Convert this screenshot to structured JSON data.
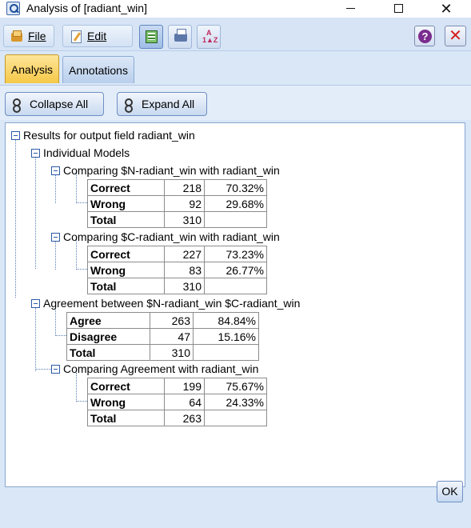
{
  "window": {
    "title": "Analysis of [radiant_win]"
  },
  "menubar": {
    "file_label": "File",
    "edit_label": "Edit"
  },
  "tabs": [
    {
      "label": "Analysis",
      "active": true
    },
    {
      "label": "Annotations",
      "active": false
    }
  ],
  "toolrow": {
    "collapse_label": "Collapse All",
    "expand_label": "Expand All"
  },
  "tree": {
    "root": "Results for output field radiant_win",
    "individual": "Individual Models",
    "cmp_n": "Comparing $N-radiant_win with radiant_win",
    "cmp_c": "Comparing $C-radiant_win with radiant_win",
    "agreement": "Agreement between  $N-radiant_win $C-radiant_win",
    "cmp_agree": "Comparing Agreement with radiant_win"
  },
  "tables": {
    "n_model": [
      {
        "label": "Correct",
        "count": "218",
        "pct": "70.32%"
      },
      {
        "label": "Wrong",
        "count": "92",
        "pct": "29.68%"
      },
      {
        "label": "Total",
        "count": "310",
        "pct": ""
      }
    ],
    "c_model": [
      {
        "label": "Correct",
        "count": "227",
        "pct": "73.23%"
      },
      {
        "label": "Wrong",
        "count": "83",
        "pct": "26.77%"
      },
      {
        "label": "Total",
        "count": "310",
        "pct": ""
      }
    ],
    "agreement": [
      {
        "label": "Agree",
        "count": "263",
        "pct": "84.84%"
      },
      {
        "label": "Disagree",
        "count": "47",
        "pct": "15.16%"
      },
      {
        "label": "Total",
        "count": "310",
        "pct": ""
      }
    ],
    "agree_vs_target": [
      {
        "label": "Correct",
        "count": "199",
        "pct": "75.67%"
      },
      {
        "label": "Wrong",
        "count": "64",
        "pct": "24.33%"
      },
      {
        "label": "Total",
        "count": "263",
        "pct": ""
      }
    ]
  },
  "footer": {
    "ok_label": "OK"
  },
  "icons": {
    "app": "magnifier-icon",
    "file": "folder-icon",
    "edit": "edit-icon",
    "table": "table-output-icon",
    "print": "print-icon",
    "sort": "sort-icon",
    "help": "help-icon",
    "close": "close-icon"
  },
  "colors": {
    "frame_bg": "#d9e7f7",
    "active_tab": "#f6c847",
    "tree_lines": "#5c7fb8",
    "close_red": "#d61e1e",
    "help_purple": "#7b2d8f"
  }
}
